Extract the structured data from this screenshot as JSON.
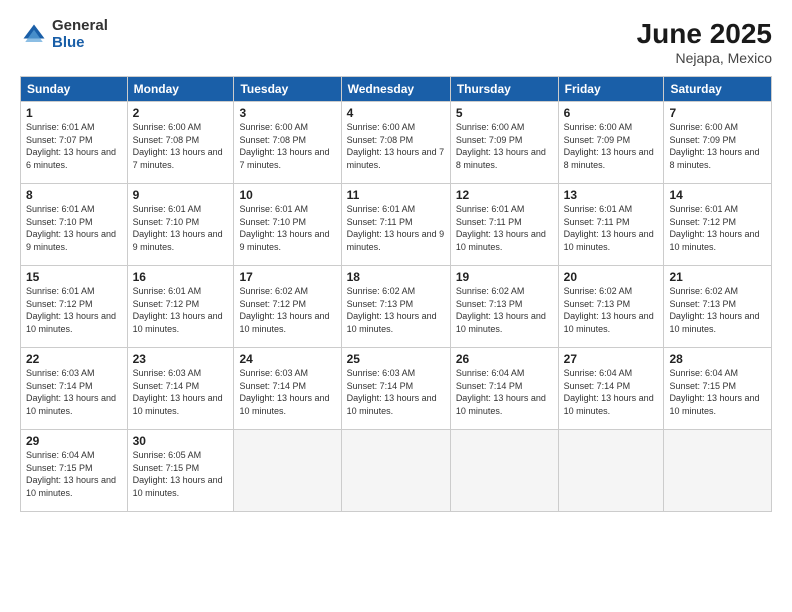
{
  "logo": {
    "general": "General",
    "blue": "Blue"
  },
  "title": {
    "month": "June 2025",
    "location": "Nejapa, Mexico"
  },
  "header": {
    "days": [
      "Sunday",
      "Monday",
      "Tuesday",
      "Wednesday",
      "Thursday",
      "Friday",
      "Saturday"
    ]
  },
  "weeks": [
    [
      {
        "day": "1",
        "sunrise": "6:01 AM",
        "sunset": "7:07 PM",
        "daylight": "13 hours and 6 minutes."
      },
      {
        "day": "2",
        "sunrise": "6:00 AM",
        "sunset": "7:08 PM",
        "daylight": "13 hours and 7 minutes."
      },
      {
        "day": "3",
        "sunrise": "6:00 AM",
        "sunset": "7:08 PM",
        "daylight": "13 hours and 7 minutes."
      },
      {
        "day": "4",
        "sunrise": "6:00 AM",
        "sunset": "7:08 PM",
        "daylight": "13 hours and 7 minutes."
      },
      {
        "day": "5",
        "sunrise": "6:00 AM",
        "sunset": "7:09 PM",
        "daylight": "13 hours and 8 minutes."
      },
      {
        "day": "6",
        "sunrise": "6:00 AM",
        "sunset": "7:09 PM",
        "daylight": "13 hours and 8 minutes."
      },
      {
        "day": "7",
        "sunrise": "6:00 AM",
        "sunset": "7:09 PM",
        "daylight": "13 hours and 8 minutes."
      }
    ],
    [
      {
        "day": "8",
        "sunrise": "6:01 AM",
        "sunset": "7:10 PM",
        "daylight": "13 hours and 9 minutes."
      },
      {
        "day": "9",
        "sunrise": "6:01 AM",
        "sunset": "7:10 PM",
        "daylight": "13 hours and 9 minutes."
      },
      {
        "day": "10",
        "sunrise": "6:01 AM",
        "sunset": "7:10 PM",
        "daylight": "13 hours and 9 minutes."
      },
      {
        "day": "11",
        "sunrise": "6:01 AM",
        "sunset": "7:11 PM",
        "daylight": "13 hours and 9 minutes."
      },
      {
        "day": "12",
        "sunrise": "6:01 AM",
        "sunset": "7:11 PM",
        "daylight": "13 hours and 10 minutes."
      },
      {
        "day": "13",
        "sunrise": "6:01 AM",
        "sunset": "7:11 PM",
        "daylight": "13 hours and 10 minutes."
      },
      {
        "day": "14",
        "sunrise": "6:01 AM",
        "sunset": "7:12 PM",
        "daylight": "13 hours and 10 minutes."
      }
    ],
    [
      {
        "day": "15",
        "sunrise": "6:01 AM",
        "sunset": "7:12 PM",
        "daylight": "13 hours and 10 minutes."
      },
      {
        "day": "16",
        "sunrise": "6:01 AM",
        "sunset": "7:12 PM",
        "daylight": "13 hours and 10 minutes."
      },
      {
        "day": "17",
        "sunrise": "6:02 AM",
        "sunset": "7:12 PM",
        "daylight": "13 hours and 10 minutes."
      },
      {
        "day": "18",
        "sunrise": "6:02 AM",
        "sunset": "7:13 PM",
        "daylight": "13 hours and 10 minutes."
      },
      {
        "day": "19",
        "sunrise": "6:02 AM",
        "sunset": "7:13 PM",
        "daylight": "13 hours and 10 minutes."
      },
      {
        "day": "20",
        "sunrise": "6:02 AM",
        "sunset": "7:13 PM",
        "daylight": "13 hours and 10 minutes."
      },
      {
        "day": "21",
        "sunrise": "6:02 AM",
        "sunset": "7:13 PM",
        "daylight": "13 hours and 10 minutes."
      }
    ],
    [
      {
        "day": "22",
        "sunrise": "6:03 AM",
        "sunset": "7:14 PM",
        "daylight": "13 hours and 10 minutes."
      },
      {
        "day": "23",
        "sunrise": "6:03 AM",
        "sunset": "7:14 PM",
        "daylight": "13 hours and 10 minutes."
      },
      {
        "day": "24",
        "sunrise": "6:03 AM",
        "sunset": "7:14 PM",
        "daylight": "13 hours and 10 minutes."
      },
      {
        "day": "25",
        "sunrise": "6:03 AM",
        "sunset": "7:14 PM",
        "daylight": "13 hours and 10 minutes."
      },
      {
        "day": "26",
        "sunrise": "6:04 AM",
        "sunset": "7:14 PM",
        "daylight": "13 hours and 10 minutes."
      },
      {
        "day": "27",
        "sunrise": "6:04 AM",
        "sunset": "7:14 PM",
        "daylight": "13 hours and 10 minutes."
      },
      {
        "day": "28",
        "sunrise": "6:04 AM",
        "sunset": "7:15 PM",
        "daylight": "13 hours and 10 minutes."
      }
    ],
    [
      {
        "day": "29",
        "sunrise": "6:04 AM",
        "sunset": "7:15 PM",
        "daylight": "13 hours and 10 minutes."
      },
      {
        "day": "30",
        "sunrise": "6:05 AM",
        "sunset": "7:15 PM",
        "daylight": "13 hours and 10 minutes."
      },
      null,
      null,
      null,
      null,
      null
    ]
  ]
}
